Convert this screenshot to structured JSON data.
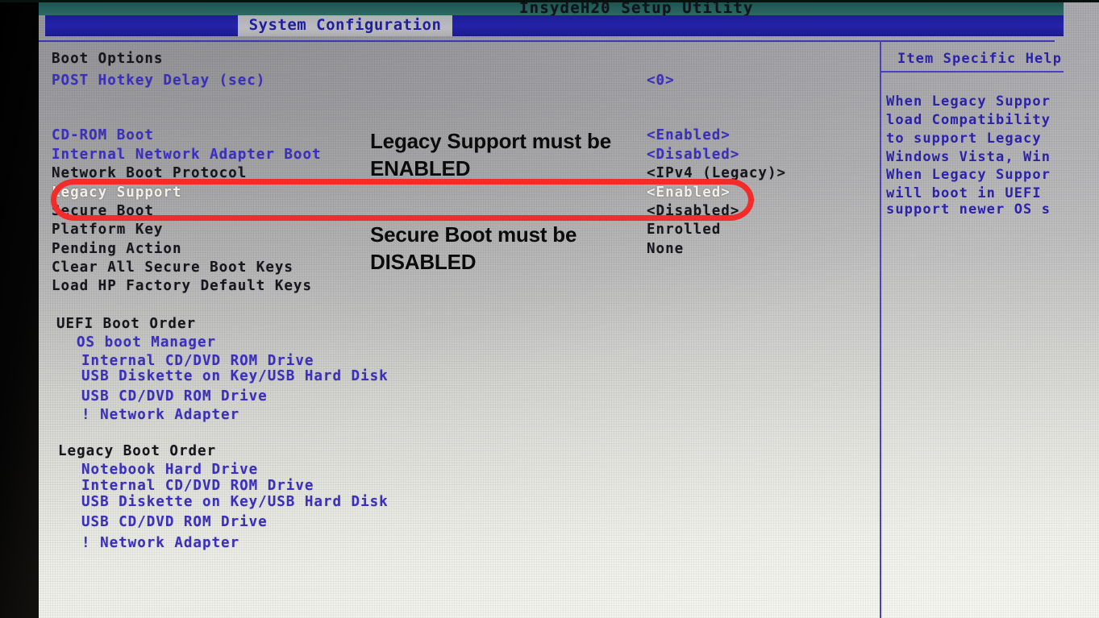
{
  "app": {
    "title": "InsydeH20 Setup Utility",
    "active_tab": "System Configuration"
  },
  "colors": {
    "titlebar_teal": "#255f5b",
    "menubar_blue": "#2323a8",
    "bios_text_blue": "#3a2fbf",
    "bios_text_black": "#17161c",
    "selected_row": "#f3efe6",
    "annotation_red": "#f22b2b",
    "annotation_black": "#0b0b0b"
  },
  "main": {
    "section_heading": "Boot Options",
    "settings": [
      {
        "label": "POST Hotkey Delay (sec)",
        "value": "<0>",
        "label_color": "blue",
        "value_color": "blue",
        "selected": false
      },
      {
        "label": "CD-ROM Boot",
        "value": "<Enabled>",
        "label_color": "blue",
        "value_color": "blue",
        "selected": false
      },
      {
        "label": "Internal Network Adapter Boot",
        "value": "<Disabled>",
        "label_color": "blue",
        "value_color": "blue",
        "selected": false
      },
      {
        "label": "Network Boot Protocol",
        "value": "<IPv4 (Legacy)>",
        "label_color": "black",
        "value_color": "black",
        "selected": false
      },
      {
        "label": "Legacy Support",
        "value": "<Enabled>",
        "label_color": "white",
        "value_color": "white",
        "selected": true
      },
      {
        "label": "Secure Boot",
        "value": "<Disabled>",
        "label_color": "black",
        "value_color": "black",
        "selected": false
      },
      {
        "label": "Platform Key",
        "value": "Enrolled",
        "label_color": "black",
        "value_color": "black",
        "selected": false
      },
      {
        "label": "Pending Action",
        "value": "None",
        "label_color": "black",
        "value_color": "black",
        "selected": false
      },
      {
        "label": "Clear All Secure Boot Keys",
        "value": "",
        "label_color": "black",
        "value_color": "black",
        "selected": false
      },
      {
        "label": "Load HP Factory Default Keys",
        "value": "",
        "label_color": "black",
        "value_color": "black",
        "selected": false
      }
    ],
    "uefi_boot_order": {
      "heading": "UEFI Boot Order",
      "items": [
        "OS boot Manager",
        "Internal CD/DVD ROM Drive",
        "USB Diskette on Key/USB Hard Disk",
        "USB CD/DVD ROM Drive",
        "! Network Adapter"
      ]
    },
    "legacy_boot_order": {
      "heading": "Legacy Boot Order",
      "items": [
        "Notebook Hard Drive",
        "Internal CD/DVD ROM Drive",
        "USB Diskette on Key/USB Hard Disk",
        "USB CD/DVD ROM Drive",
        "! Network Adapter"
      ]
    }
  },
  "help_panel": {
    "title": "Item Specific Help",
    "lines": [
      "When Legacy Suppor",
      "load Compatibility",
      "to support Legacy",
      "Windows Vista, Win",
      "When Legacy Suppor",
      "will boot in UEFI",
      "support newer OS s"
    ]
  },
  "annotations": [
    {
      "text": "Legacy Support must be\nENABLED",
      "name": "annotation-legacy-support"
    },
    {
      "text": "Secure Boot must be\nDISABLED",
      "name": "annotation-secure-boot"
    }
  ]
}
